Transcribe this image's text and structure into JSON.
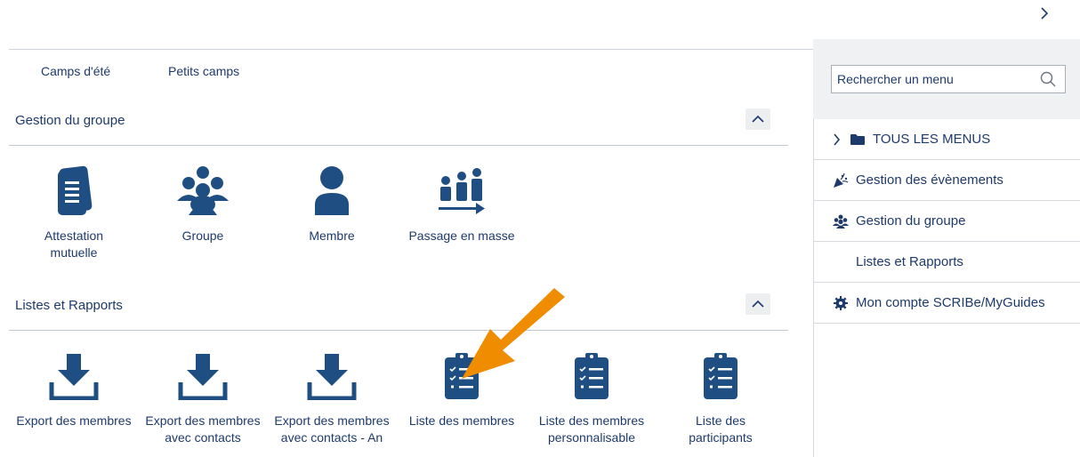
{
  "header": {
    "collapse_icon": "chevron-right-icon"
  },
  "tabs": [
    {
      "label": "Camps d'été"
    },
    {
      "label": "Petits camps"
    }
  ],
  "sections": [
    {
      "title": "Gestion du groupe",
      "tiles": [
        {
          "label": "Attestation mutuelle",
          "icon": "document-list-icon"
        },
        {
          "label": "Groupe",
          "icon": "group-icon"
        },
        {
          "label": "Membre",
          "icon": "user-icon"
        },
        {
          "label": "Passage en masse",
          "icon": "mass-transfer-icon"
        }
      ]
    },
    {
      "title": "Listes et Rapports",
      "tiles": [
        {
          "label": "Export des membres",
          "icon": "download-icon"
        },
        {
          "label": "Export des membres avec contacts",
          "icon": "download-icon"
        },
        {
          "label": "Export des membres avec contacts - An",
          "icon": "download-icon"
        },
        {
          "label": "Liste des membres",
          "icon": "clipboard-list-icon"
        },
        {
          "label": "Liste des membres personnalisable",
          "icon": "clipboard-list-icon"
        },
        {
          "label": "Liste des participants",
          "icon": "clipboard-list-icon"
        }
      ]
    }
  ],
  "sidebar": {
    "search_placeholder": "Rechercher un menu",
    "items": [
      {
        "label": "TOUS LES MENUS",
        "icon": "folder-icon"
      },
      {
        "label": "Gestion des évènements",
        "icon": "party-popper-icon"
      },
      {
        "label": "Gestion du groupe",
        "icon": "group-icon"
      },
      {
        "label": "Listes et Rapports",
        "icon": ""
      },
      {
        "label": "Mon compte SCRIBe/MyGuides",
        "icon": "gear-icon"
      }
    ]
  },
  "annotation": {
    "arrow_color": "#f08c00"
  },
  "colors": {
    "primary": "#1d3a6b",
    "icon": "#1f4f82"
  }
}
